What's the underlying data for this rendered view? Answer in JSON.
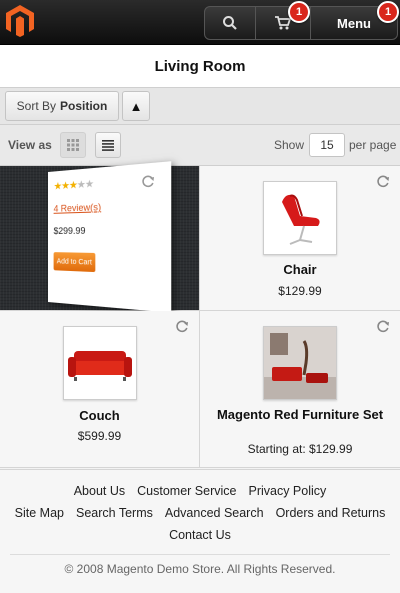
{
  "header": {
    "menu_label": "Menu",
    "cart_badge": "1",
    "menu_badge": "1",
    "icons": [
      "magento-logo-icon",
      "search-icon",
      "cart-icon"
    ]
  },
  "page": {
    "title": "Living Room"
  },
  "toolbar": {
    "sort_prefix": "Sort By",
    "sort_value": "Position",
    "sort_direction_icon": "▲",
    "view_as_label": "View as",
    "show_label": "Show",
    "show_value": "15",
    "per_page_label": "per page"
  },
  "products": [
    {
      "name": "",
      "price": "$299.99",
      "reviews": "4 Review(s)",
      "add_to_cart": "Add to Cart",
      "rating": 3,
      "rating_max": 5,
      "flipped": true
    },
    {
      "name": "Chair",
      "price": "$129.99"
    },
    {
      "name": "Couch",
      "price": "$599.99"
    },
    {
      "name": "Magento Red Furniture Set",
      "price": "Starting at: $129.99"
    }
  ],
  "footer": {
    "links_row1": [
      "About Us",
      "Customer Service",
      "Privacy Policy"
    ],
    "links_row2": [
      "Site Map",
      "Search Terms",
      "Advanced Search",
      "Orders and Returns"
    ],
    "links_row3": [
      "Contact Us"
    ],
    "copyright": "© 2008 Magento Demo Store. All Rights Reserved."
  },
  "colors": {
    "accent_orange": "#f26322",
    "badge_red": "#d9261c",
    "header_dark": "#1b1b1b"
  }
}
